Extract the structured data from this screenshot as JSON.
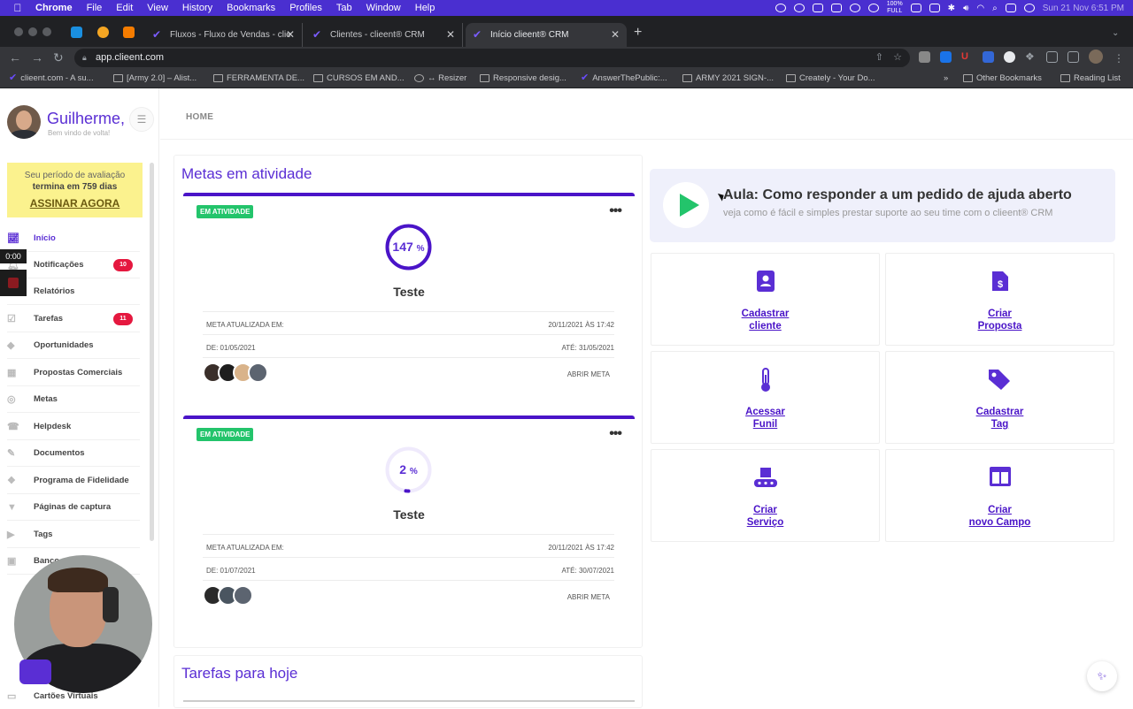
{
  "menubar": {
    "app": "Chrome",
    "items": [
      "File",
      "Edit",
      "View",
      "History",
      "Bookmarks",
      "Profiles",
      "Tab",
      "Window",
      "Help"
    ],
    "battery": "100%",
    "battery_sub": "FULL",
    "datetime": "Sun 21 Nov  6:51 PM"
  },
  "tabs": [
    {
      "title": "Fluxos - Fluxo de Vendas - clie"
    },
    {
      "title": "Clientes - clieent® CRM"
    },
    {
      "title": "Início clieent® CRM"
    }
  ],
  "address": {
    "url": "app.clieent.com"
  },
  "bookmarks": [
    "clieent.com - A su...",
    "[Army 2.0] – Alist...",
    "FERRAMENTA DE...",
    "CURSOS EM AND...",
    "↔ Resizer",
    "Responsive desig...",
    "AnswerThePublic:...",
    "ARMY 2021 SIGN-...",
    "Creately - Your Do...",
    "Other Bookmarks",
    "Reading List"
  ],
  "user": {
    "name": "Guilherme,",
    "subtitle": "Bem vindo de volta!"
  },
  "trial": {
    "line1": "Seu período de avaliação",
    "line2": "termina em 759 dias",
    "cta": "ASSINAR AGORA"
  },
  "recorder": {
    "time": "0:00"
  },
  "sidebar": {
    "items": [
      {
        "label": "Início",
        "icon": "chart-icon"
      },
      {
        "label": "Notificações",
        "icon": "bell-icon",
        "badge": "10"
      },
      {
        "label": "Relatórios",
        "icon": "report-icon"
      },
      {
        "label": "Tarefas",
        "icon": "task-icon",
        "badge": "11"
      },
      {
        "label": "Oportunidades",
        "icon": "opportunity-icon"
      },
      {
        "label": "Propostas Comerciais",
        "icon": "proposal-icon"
      },
      {
        "label": "Metas",
        "icon": "target-icon"
      },
      {
        "label": "Helpdesk",
        "icon": "headset-icon"
      },
      {
        "label": "Documentos",
        "icon": "document-icon"
      },
      {
        "label": "Programa de Fidelidade",
        "icon": "loyalty-icon"
      },
      {
        "label": "Páginas de captura",
        "icon": "funnel-icon"
      },
      {
        "label": "Tags",
        "icon": "tag-icon"
      },
      {
        "label": "Banco...",
        "icon": "bank-icon"
      },
      {
        "label": "Cartões Virtuais",
        "icon": "card-icon"
      }
    ]
  },
  "breadcrumb": "HOME",
  "goals": {
    "title": "Metas em atividade",
    "cards": [
      {
        "status": "EM ATIVIDADE",
        "percent": "147",
        "percent_sign": "%",
        "progress": 1.0,
        "name": "Teste",
        "updated_label": "META ATUALIZADA EM:",
        "updated_value": "20/11/2021 ÀS 17:42",
        "from": "DE: 01/05/2021",
        "to": "ATÉ: 31/05/2021",
        "link": "ABRIR META",
        "avatars": 4
      },
      {
        "status": "EM ATIVIDADE",
        "percent": "2",
        "percent_sign": "%",
        "progress": 0.02,
        "name": "Teste",
        "updated_label": "META ATUALIZADA EM:",
        "updated_value": "20/11/2021 ÀS 17:42",
        "from": "DE: 01/07/2021",
        "to": "ATÉ: 30/07/2021",
        "link": "ABRIR META",
        "avatars": 3
      }
    ]
  },
  "tasks_panel": {
    "title": "Tarefas para hoje"
  },
  "banner": {
    "title": "Aula: Como responder a um pedido de ajuda aberto",
    "subtitle": "veja como é fácil e simples prestar suporte ao seu time com o clieent® CRM"
  },
  "actions": [
    {
      "line1": "Cadastrar",
      "line2": "cliente",
      "icon": "contact-book-icon"
    },
    {
      "line1": "Criar",
      "line2": "Proposta",
      "icon": "invoice-dollar-icon"
    },
    {
      "line1": "Acessar",
      "line2": "Funil",
      "icon": "thermometer-icon"
    },
    {
      "line1": "Cadastrar",
      "line2": "Tag",
      "icon": "tags-icon"
    },
    {
      "line1": "Criar",
      "line2": "Serviço",
      "icon": "conveyor-icon"
    },
    {
      "line1": "Criar",
      "line2": "novo Campo",
      "icon": "columns-icon"
    }
  ],
  "colors": {
    "accent": "#5a2ed4",
    "success": "#23c46b",
    "badge": "#e5183f",
    "trial_bg": "#fbf28e"
  }
}
